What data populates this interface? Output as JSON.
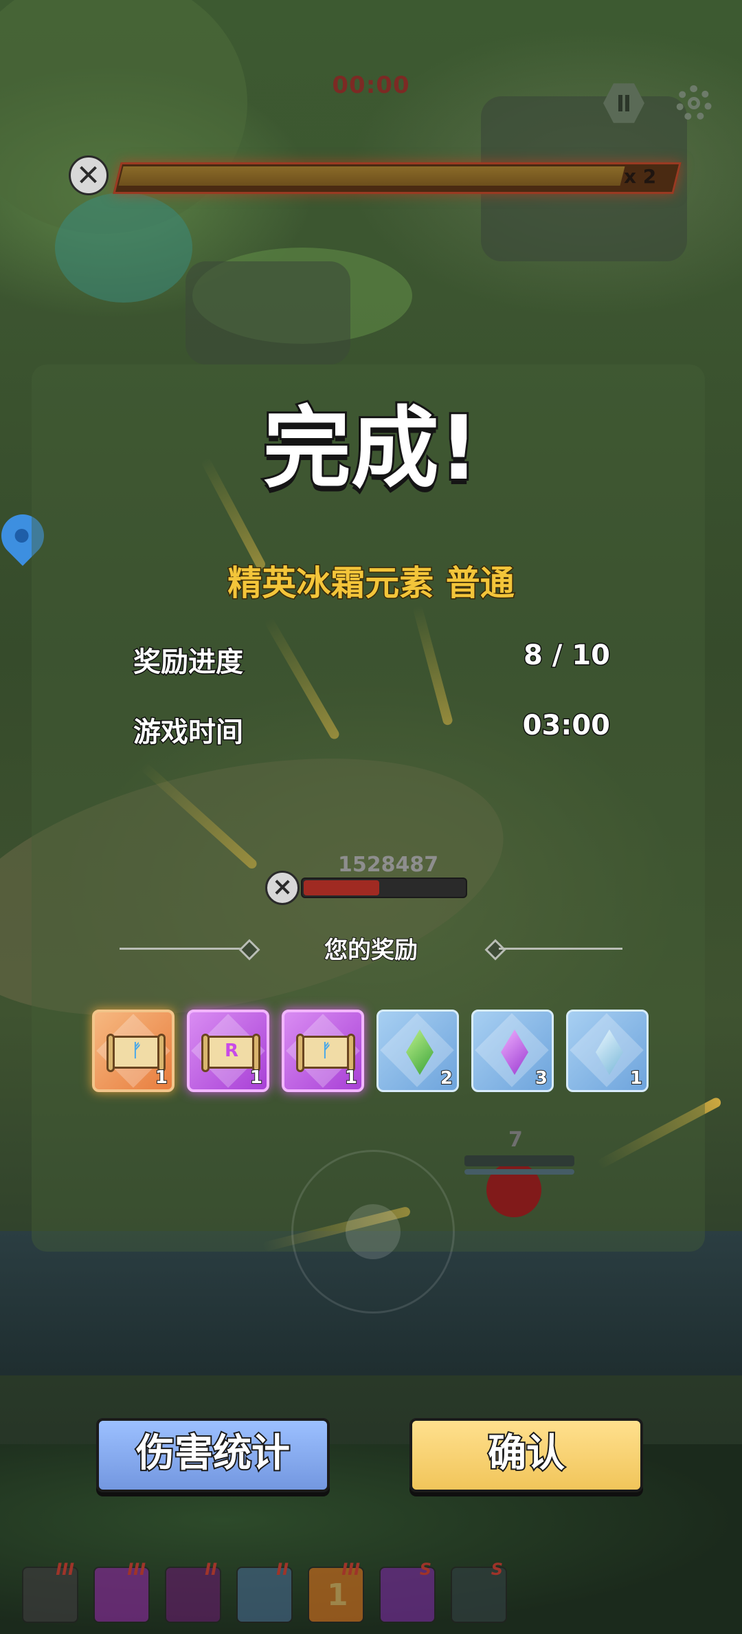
{
  "hud": {
    "timer": "00:00",
    "boss_multiplier": "x 2",
    "pause_icon": "pause-icon",
    "settings_icon": "gear-icon"
  },
  "result": {
    "title": "完成!",
    "stage_name": "精英冰霜元素 普通",
    "stats": [
      {
        "label": "奖励进度",
        "value": "8 / 10"
      },
      {
        "label": "游戏时间",
        "value": "03:00"
      }
    ]
  },
  "scene": {
    "enemy_hp_number": "1528487",
    "small_enemy_number": "7"
  },
  "rewards": {
    "title": "您的奖励",
    "items": [
      {
        "kind": "rune-scroll",
        "rarity": "orange",
        "rune": "ᚠ",
        "count": "1"
      },
      {
        "kind": "rune-scroll",
        "rarity": "purple",
        "rune": "R",
        "count": "1"
      },
      {
        "kind": "rune-scroll",
        "rarity": "purple",
        "rune": "ᚠ",
        "count": "1"
      },
      {
        "kind": "gem",
        "rarity": "blue",
        "gem": "green",
        "count": "2"
      },
      {
        "kind": "gem",
        "rarity": "blue",
        "gem": "violet",
        "count": "3"
      },
      {
        "kind": "gem",
        "rarity": "blue",
        "gem": "ice",
        "count": "1"
      }
    ]
  },
  "buttons": {
    "damage_stats": "伤害统计",
    "confirm": "确认"
  },
  "skills": [
    {
      "tier": "III",
      "color": "#3a3a3a",
      "level": ""
    },
    {
      "tier": "III",
      "color": "#7a2a8a",
      "level": ""
    },
    {
      "tier": "II",
      "color": "#5a1f5f",
      "level": ""
    },
    {
      "tier": "II",
      "color": "#3f5f7a",
      "level": ""
    },
    {
      "tier": "III",
      "color": "#b8661e",
      "level": "1"
    },
    {
      "tier": "S",
      "color": "#6a2a8a",
      "level": ""
    },
    {
      "tier": "S",
      "color": "#2f3d3d",
      "level": ""
    }
  ],
  "colors": {
    "title_text": "#ffffff",
    "stage_name": "#f3c53a",
    "damage_button": "#7397e0",
    "confirm_button": "#f1c55a"
  }
}
